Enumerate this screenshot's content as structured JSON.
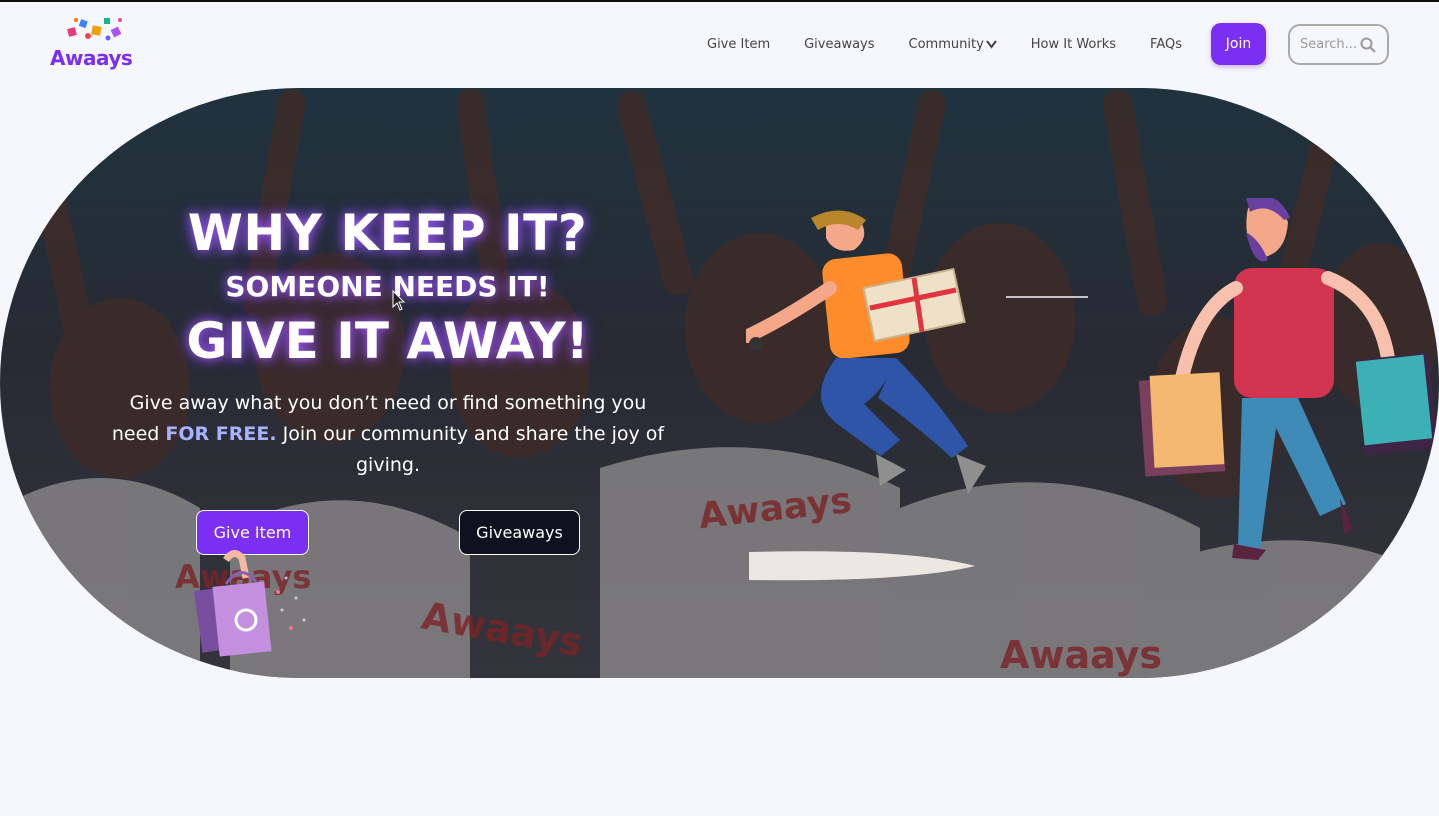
{
  "brand": {
    "name": "Awaays",
    "color": "#7b2ff2"
  },
  "nav": {
    "links": [
      {
        "label": "Give Item"
      },
      {
        "label": "Giveaways"
      },
      {
        "label": "Community",
        "has_dropdown": true,
        "icon": "chevron-down-icon"
      },
      {
        "label": "How It Works"
      },
      {
        "label": "FAQs"
      }
    ],
    "join_label": "Join",
    "search_placeholder": "Search..."
  },
  "hero": {
    "line1": "WHY KEEP IT?",
    "line2": "SOMEONE NEEDS IT!",
    "line3": "GIVE IT AWAY!",
    "lead_part1": "Give away what you don’t need or find something you need ",
    "lead_highlight": "FOR FREE.",
    "lead_part2": " Join our community and share the joy of giving.",
    "primary_button": "Give Item",
    "secondary_button": "Giveaways",
    "shirt_text": "Awaays"
  },
  "colors": {
    "accent": "#7b2ff2",
    "highlight": "#a7b3ff",
    "page_bg": "#f6f6fd"
  }
}
